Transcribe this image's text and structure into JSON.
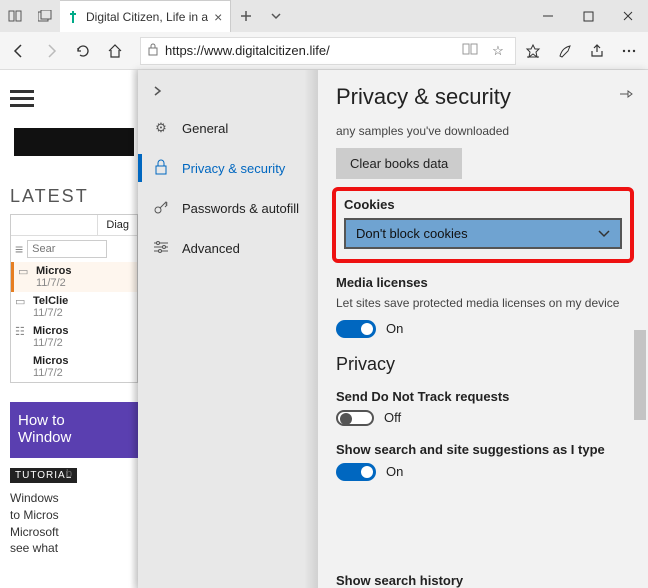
{
  "titlebar": {
    "tab_title": "Digital Citizen, Life in a"
  },
  "toolbar": {
    "url": "https://www.digitalcitizen.life/"
  },
  "page": {
    "latest": "LATEST",
    "diag": "Diag",
    "search_placeholder": "Sear",
    "rows": [
      {
        "title": "Micros",
        "date": "11/7/2"
      },
      {
        "title": "TelClie",
        "date": "11/7/2"
      },
      {
        "title": "Micros",
        "date": "11/7/2"
      },
      {
        "title": "Micros",
        "date": "11/7/2"
      }
    ],
    "promo_line1": "How to",
    "promo_line2": "Window",
    "tag": "TUTORIAL",
    "tag_suffix": "b",
    "para": "Windows\nto Micros\nMicrosoft\nsee what"
  },
  "nav": {
    "items": [
      {
        "label": "General"
      },
      {
        "label": "Privacy & security"
      },
      {
        "label": "Passwords & autofill"
      },
      {
        "label": "Advanced"
      }
    ]
  },
  "panel": {
    "title": "Privacy & security",
    "samples": "any samples you've downloaded",
    "clear_btn": "Clear books data",
    "cookies_heading": "Cookies",
    "cookies_value": "Don't block cookies",
    "media_heading": "Media licenses",
    "media_desc": "Let sites save protected media licenses on my device",
    "on": "On",
    "off": "Off",
    "privacy_heading": "Privacy",
    "dnt_heading": "Send Do Not Track requests",
    "suggest_heading": "Show search and site suggestions as I type",
    "history_heading": "Show search history"
  }
}
